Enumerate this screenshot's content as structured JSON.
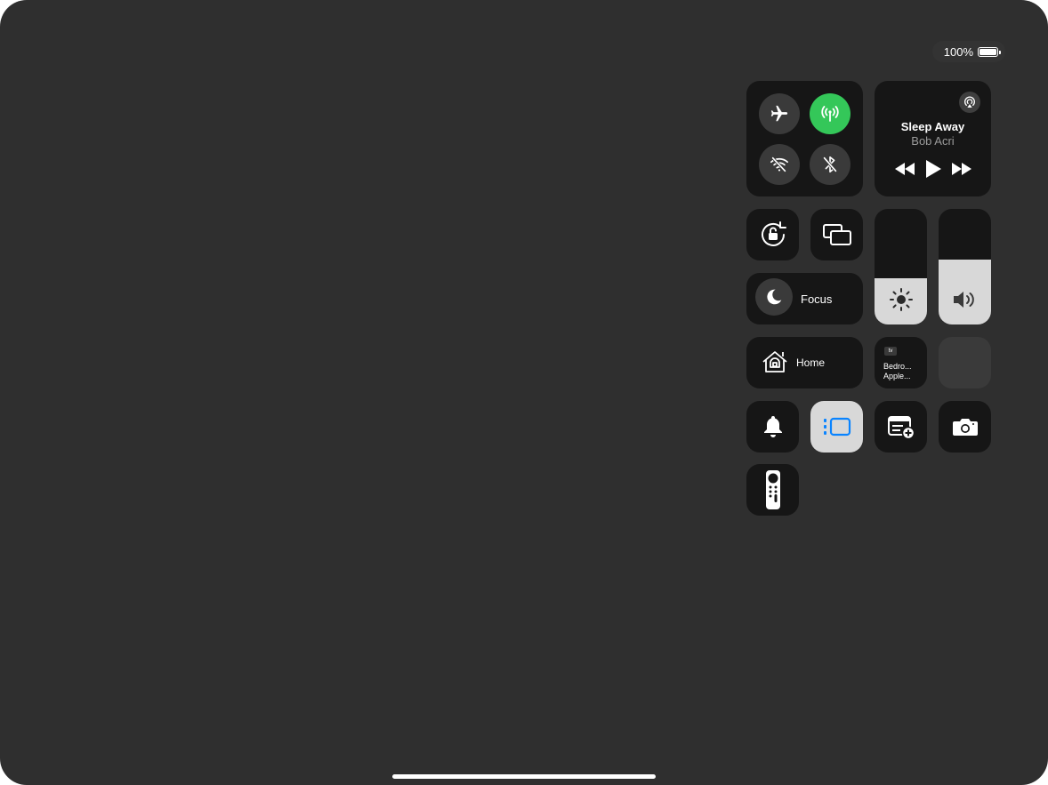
{
  "status_bar": {
    "battery_text": "100%",
    "battery_level": 1.0
  },
  "connectivity": {
    "airplane_mode": false,
    "cellular_data": true,
    "wifi": false,
    "bluetooth": false
  },
  "now_playing": {
    "title": "Sleep Away",
    "artist": "Bob Acri",
    "state": "paused"
  },
  "focus": {
    "label": "Focus"
  },
  "home": {
    "label": "Home"
  },
  "apple_tv": {
    "badge": "tv",
    "line1": "Bedro...",
    "line2": "Apple..."
  },
  "brightness": {
    "level": 0.4
  },
  "volume": {
    "level": 0.56
  },
  "colors": {
    "screen_bg": "#2f2f2f",
    "tile_bg": "#161616",
    "circle_bg": "#3a3a3a",
    "active_green": "#34c759",
    "accent_blue": "#0a84ff",
    "slider_fill": "#d8d8d8"
  },
  "icons": {
    "airplane": "airplane-icon",
    "cellular": "antenna-icon",
    "wifi": "wifi-off-icon",
    "bluetooth": "bluetooth-off-icon",
    "airplay": "airplay-icon",
    "rotation_lock": "rotation-lock-icon",
    "screen_mirroring": "screen-mirroring-icon",
    "focus": "moon-icon",
    "home": "home-icon",
    "brightness": "sun-icon",
    "volume": "speaker-icon",
    "silent": "bell-icon",
    "stage_manager": "stage-manager-icon",
    "quick_note": "quick-note-icon",
    "camera": "camera-icon",
    "remote": "apple-tv-remote-icon"
  }
}
